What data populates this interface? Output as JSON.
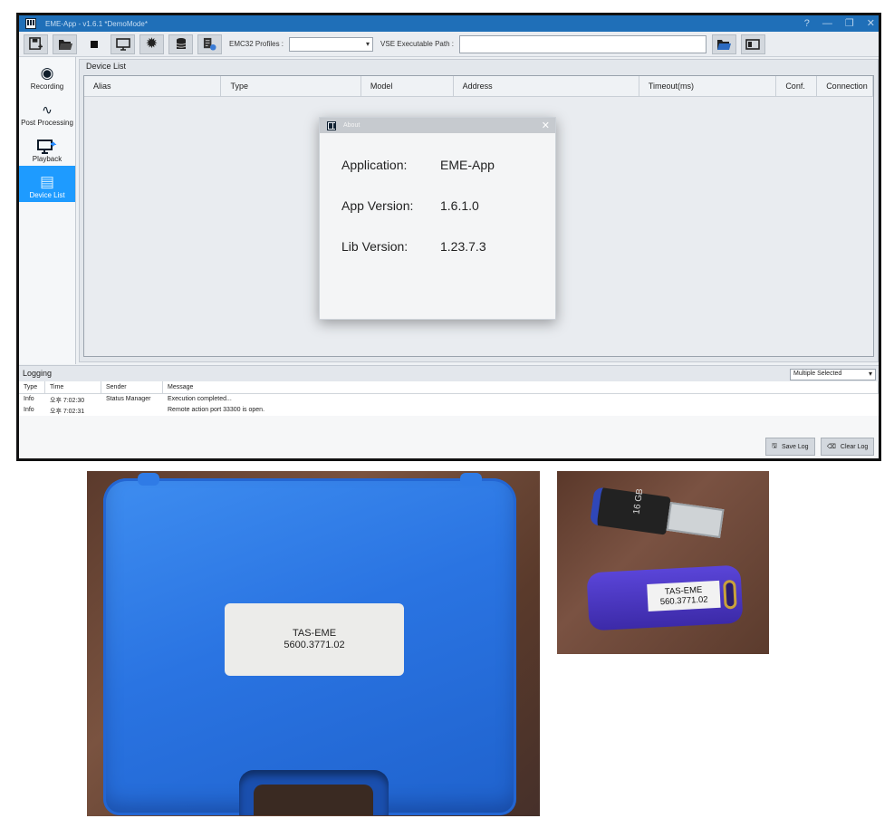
{
  "window": {
    "title": "EME-App - v1.6.1 *DemoMode*",
    "help_icon": "help-icon",
    "minimize_glyph": "—",
    "maximize_glyph": "❐",
    "close_glyph": "✕"
  },
  "toolbar": {
    "emc32_label": "EMC32 Profiles :",
    "emc32_value": "",
    "vse_label": "VSE Executable Path :",
    "vse_value": ""
  },
  "sidebar": {
    "items": [
      {
        "label": "Recording",
        "icon": "record-icon"
      },
      {
        "label": "Post Processing",
        "icon": "waveform-icon"
      },
      {
        "label": "Playback",
        "icon": "monitor-playback-icon"
      },
      {
        "label": "Device List",
        "icon": "device-list-icon",
        "active": true
      }
    ]
  },
  "device_list": {
    "title": "Device List",
    "columns": [
      "Alias",
      "Type",
      "Model",
      "Address",
      "Timeout(ms)",
      "Conf.",
      "Connection"
    ]
  },
  "about": {
    "title": "About",
    "app_key": "Application:",
    "app_val": "EME-App",
    "ver_key": "App Version:",
    "ver_val": "1.6.1.0",
    "lib_key": "Lib Version:",
    "lib_val": "1.23.7.3"
  },
  "logging": {
    "title": "Logging",
    "filter": "Multiple Selected",
    "columns": [
      "Type",
      "Time",
      "Sender",
      "Message"
    ],
    "rows": [
      {
        "type": "Info",
        "time": "오후 7:02:30",
        "sender": "Status Manager",
        "message": "Execution completed..."
      },
      {
        "type": "Info",
        "time": "오후 7:02:31",
        "sender": "",
        "message": "Remote action port 33300 is open."
      }
    ],
    "save_label": "Save Log",
    "clear_label": "Clear Log"
  },
  "photos": {
    "case_label_line1": "TAS-EME",
    "case_label_line2": "5600.3771.02",
    "usb_capacity": "16 GB",
    "dongle_line1": "TAS-EME",
    "dongle_line2": "560.3771.02"
  }
}
